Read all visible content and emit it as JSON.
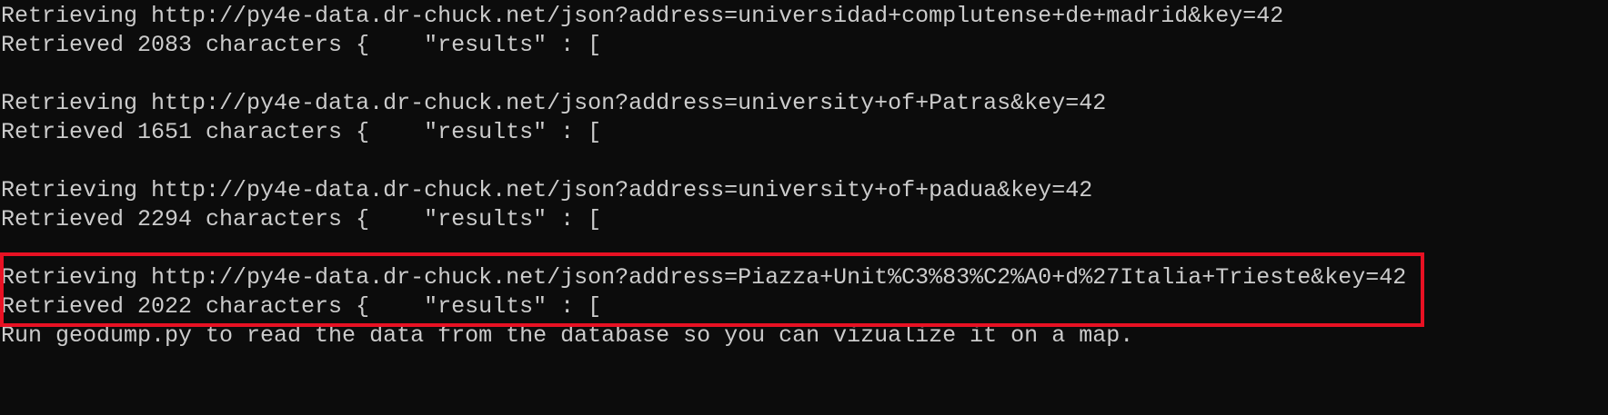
{
  "terminal": {
    "lines": [
      "Retrieving http://py4e-data.dr-chuck.net/json?address=universidad+complutense+de+madrid&key=42",
      "Retrieved 2083 characters {    \"results\" : [",
      "",
      "Retrieving http://py4e-data.dr-chuck.net/json?address=university+of+Patras&key=42",
      "Retrieved 1651 characters {    \"results\" : [",
      "",
      "Retrieving http://py4e-data.dr-chuck.net/json?address=university+of+padua&key=42",
      "Retrieved 2294 characters {    \"results\" : [",
      "",
      "Retrieving http://py4e-data.dr-chuck.net/json?address=Piazza+Unit%C3%83%C2%A0+d%27Italia+Trieste&key=42",
      "Retrieved 2022 characters {    \"results\" : [",
      "Run geodump.py to read the data from the database so you can vizualize it on a map."
    ]
  },
  "colors": {
    "background": "#0c0c0c",
    "text": "#cccccc",
    "highlight": "#e81123"
  }
}
